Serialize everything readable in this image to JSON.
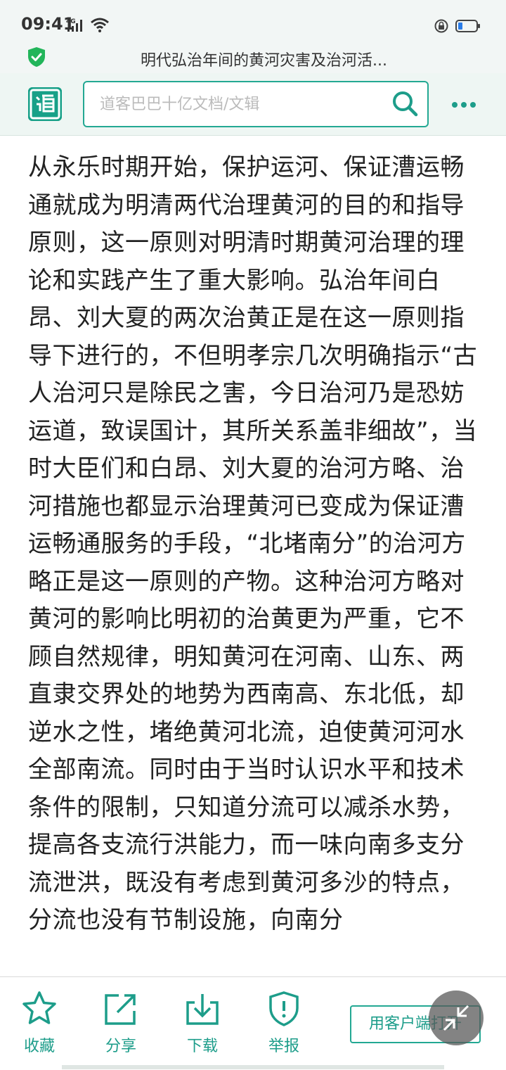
{
  "status_bar": {
    "time": "09:41",
    "network": "4G"
  },
  "tab": {
    "title": "明代弘治年间的黄河灾害及治河活..."
  },
  "header": {
    "search_placeholder": "道客巴巴十亿文档/文辑"
  },
  "content": {
    "text": "从永乐时期开始，保护运河、保证漕运畅通就成为明清两代治理黄河的目的和指导原则，这一原则对明清时期黄河治理的理论和实践产生了重大影响。弘治年间白昂、刘大夏的两次治黄正是在这一原则指导下进行的，不但明孝宗几次明确指示“古人治河只是除民之害，今日治河乃是恐妨运道，致误国计，其所关系盖非细故”，当时大臣们和白昂、刘大夏的治河方略、治河措施也都显示治理黄河已变成为保证漕运畅通服务的手段，“北堵南分”的治河方略正是这一原则的产物。这种治河方略对黄河的影响比明初的治黄更为严重，它不顾自然规律，明知黄河在河南、山东、两直隶交界处的地势为西南高、东北低，却逆水之性，堵绝黄河北流，迫使黄河河水全部南流。同时由于当时认识水平和技术条件的限制，只知道分流可以减杀水势，提高各支流行洪能力，而一味向南多支分流泄洪，既没有考虑到黄河多沙的特点，分流也没有节制设施，向南分"
  },
  "bottom_bar": {
    "favorite": "收藏",
    "share": "分享",
    "download": "下载",
    "report": "举报",
    "open_client": "用客户端打开"
  },
  "colors": {
    "accent": "#1d9d8a",
    "header_bg": "#eef6f3"
  }
}
